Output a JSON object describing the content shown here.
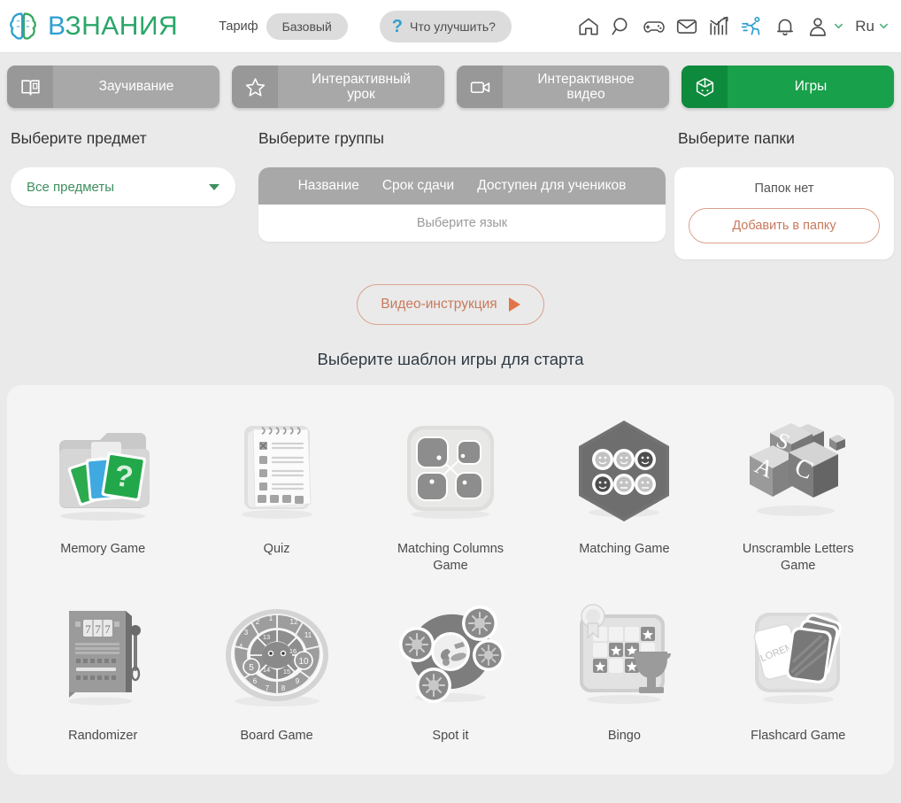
{
  "header": {
    "brand": "ВЗНАНИЯ",
    "brand_first_letter": "В",
    "tariff_label": "Тариф",
    "tariff_value": "Базовый",
    "improve_label": "Что улучшить?",
    "language": "Ru",
    "icons": [
      "home-icon",
      "search-icon",
      "gamepad-icon",
      "mail-icon",
      "stats-icon",
      "runner-icon",
      "bell-icon",
      "avatar-icon"
    ]
  },
  "tabs": [
    {
      "label": "Заучивание",
      "icon": "book-icon",
      "active": false
    },
    {
      "label": "Интерактивный\nурок",
      "icon": "star-icon",
      "active": false
    },
    {
      "label": "Интерактивное\nвидео",
      "icon": "video-icon",
      "active": false
    },
    {
      "label": "Игры",
      "icon": "dice-icon",
      "active": true
    }
  ],
  "filters": {
    "subject": {
      "title": "Выберите предмет",
      "selected": "Все предметы"
    },
    "groups": {
      "title": "Выберите группы",
      "columns": [
        "Название",
        "Срок сдачи",
        "Доступен для учеников"
      ],
      "empty_text": "Выберите язык"
    },
    "folders": {
      "title": "Выберите папки",
      "empty_text": "Папок нет",
      "add_button": "Добавить в папку"
    }
  },
  "video_instruction": {
    "label": "Видео-инструкция",
    "icon": "play-icon"
  },
  "templates": {
    "title": "Выберите шаблон игры для старта",
    "items": [
      {
        "name": "Memory Game",
        "art": "memory"
      },
      {
        "name": "Quiz",
        "art": "quiz"
      },
      {
        "name": "Matching Columns\nGame",
        "art": "matching-columns"
      },
      {
        "name": "Matching Game",
        "art": "matching"
      },
      {
        "name": "Unscramble Letters\nGame",
        "art": "unscramble"
      },
      {
        "name": "Randomizer",
        "art": "randomizer"
      },
      {
        "name": "Board Game",
        "art": "board"
      },
      {
        "name": "Spot it",
        "art": "spotit"
      },
      {
        "name": "Bingo",
        "art": "bingo"
      },
      {
        "name": "Flashcard Game",
        "art": "flashcard"
      }
    ]
  },
  "colors": {
    "accent_green": "#18a04a",
    "brand_blue": "#2f9fd0",
    "tab_gray": "#a8a8a8",
    "orange": "#c87a5e",
    "page_bg": "#eaeaea"
  }
}
